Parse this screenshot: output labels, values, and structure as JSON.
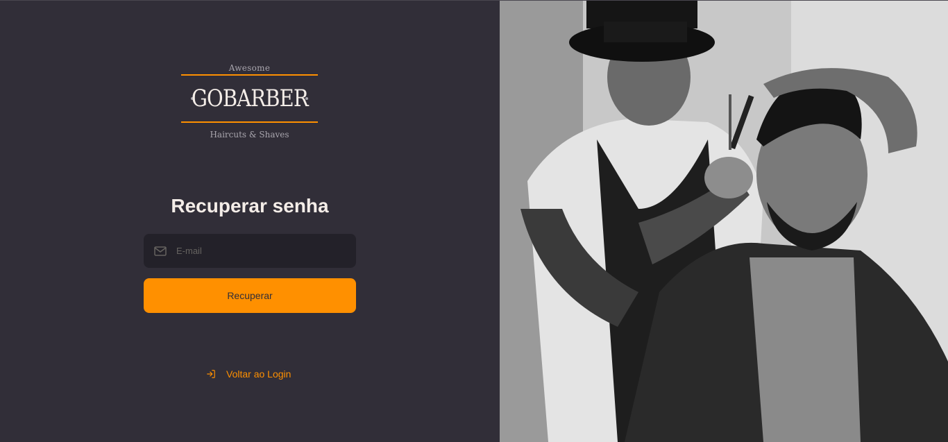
{
  "logo": {
    "top_text": "Awesome",
    "name": "GOBARBER",
    "bottom_text": "Haircuts & Shaves"
  },
  "form": {
    "title": "Recuperar senha",
    "email_placeholder": "E-mail",
    "email_value": "",
    "submit_label": "Recuperar"
  },
  "back_link": {
    "label": "Voltar ao Login",
    "icon": "log-in-icon"
  },
  "background_image": {
    "description_icon": "barber-photo"
  },
  "colors": {
    "background": "#312e38",
    "accent": "#ff9000",
    "input_bg": "#232129",
    "text": "#f4ede8",
    "placeholder": "#666360"
  }
}
